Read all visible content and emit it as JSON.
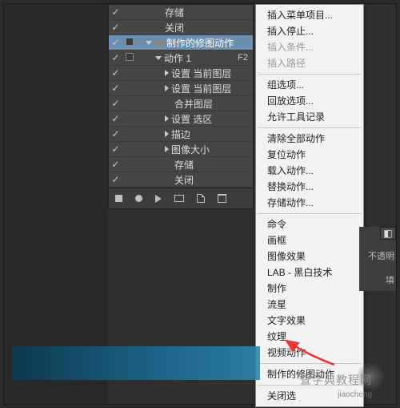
{
  "actions": {
    "rows": [
      {
        "check": true,
        "box": false,
        "indent": 36,
        "tw": "",
        "icon": "",
        "label": "存储"
      },
      {
        "check": true,
        "box": false,
        "indent": 36,
        "tw": "",
        "icon": "",
        "label": "关闭"
      },
      {
        "check": true,
        "box": true,
        "indent": 12,
        "tw": "open",
        "icon": "folder",
        "label": "制作的修图动作",
        "sel": true
      },
      {
        "check": true,
        "box": true,
        "indent": 24,
        "tw": "open",
        "icon": "",
        "label": "动作 1",
        "shortcut": "F2"
      },
      {
        "check": true,
        "box": false,
        "indent": 36,
        "tw": "closed",
        "icon": "",
        "label": "设置 当前图层"
      },
      {
        "check": true,
        "box": false,
        "indent": 36,
        "tw": "closed",
        "icon": "",
        "label": "设置 当前图层"
      },
      {
        "check": true,
        "box": false,
        "indent": 48,
        "tw": "",
        "icon": "",
        "label": "合并图层"
      },
      {
        "check": true,
        "box": false,
        "indent": 36,
        "tw": "closed",
        "icon": "",
        "label": "设置 选区"
      },
      {
        "check": true,
        "box": false,
        "indent": 36,
        "tw": "closed",
        "icon": "",
        "label": "描边"
      },
      {
        "check": true,
        "box": false,
        "indent": 36,
        "tw": "closed",
        "icon": "",
        "label": "图像大小"
      },
      {
        "check": true,
        "box": false,
        "indent": 48,
        "tw": "",
        "icon": "",
        "label": "存储"
      },
      {
        "check": true,
        "box": false,
        "indent": 48,
        "tw": "",
        "icon": "",
        "label": "关闭"
      }
    ]
  },
  "menu": {
    "items": [
      {
        "t": "插入菜单项目...",
        "d": false
      },
      {
        "t": "插入停止...",
        "d": false
      },
      {
        "t": "插入条件...",
        "d": true
      },
      {
        "t": "插入路径",
        "d": true
      },
      {
        "sep": true
      },
      {
        "t": "组选项...",
        "d": false
      },
      {
        "t": "回放选项...",
        "d": false
      },
      {
        "t": "允许工具记录",
        "d": false
      },
      {
        "sep": true
      },
      {
        "t": "清除全部动作",
        "d": false
      },
      {
        "t": "复位动作",
        "d": false
      },
      {
        "t": "载入动作...",
        "d": false
      },
      {
        "t": "替换动作...",
        "d": false
      },
      {
        "t": "存储动作...",
        "d": false
      },
      {
        "sep": true
      },
      {
        "t": "命令",
        "d": false
      },
      {
        "t": "画框",
        "d": false
      },
      {
        "t": "图像效果",
        "d": false
      },
      {
        "t": "LAB - 黑白技术",
        "d": false
      },
      {
        "t": "制作",
        "d": false
      },
      {
        "t": "流星",
        "d": false
      },
      {
        "t": "文字效果",
        "d": false
      },
      {
        "t": "纹理",
        "d": false
      },
      {
        "t": "视频动作",
        "d": false
      },
      {
        "sep": true
      },
      {
        "t": "制作的修图动作",
        "d": false
      },
      {
        "sep": true
      },
      {
        "t": "关闭选",
        "d": false
      }
    ]
  },
  "rightPanel": {
    "tab": "◧",
    "opacity": "不透明",
    "fill": "填"
  },
  "watermark": {
    "main": "查字典教程网",
    "sub": "jiaocheng"
  }
}
